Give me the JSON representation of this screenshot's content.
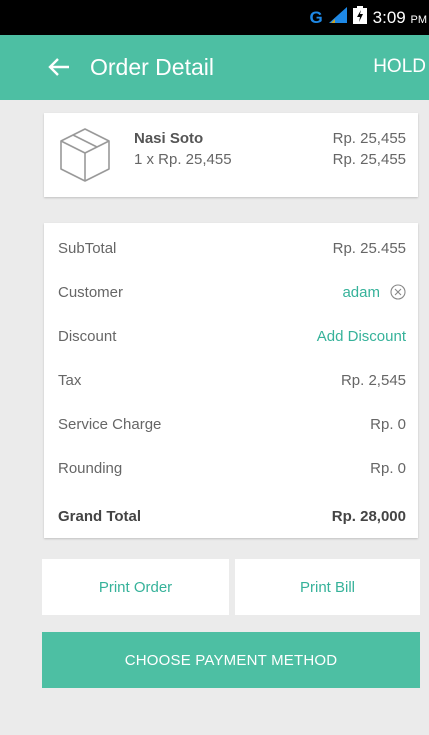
{
  "status_bar": {
    "network": "G",
    "time": "3:09",
    "ampm": "PM"
  },
  "app_bar": {
    "title": "Order Detail",
    "action": "HOLD"
  },
  "order_item": {
    "icon": "box-icon",
    "name": "Nasi Soto",
    "quantity_line": "1 x Rp. 25,455",
    "price_line_1": "Rp. 25,455",
    "price_line_2": "Rp. 25,455"
  },
  "summary": {
    "subtotal": {
      "label": "SubTotal",
      "value": "Rp. 25.455"
    },
    "customer": {
      "label": "Customer",
      "value": "adam"
    },
    "discount": {
      "label": "Discount",
      "value": "Add Discount"
    },
    "tax": {
      "label": "Tax",
      "value": "Rp. 2,545"
    },
    "service_charge": {
      "label": "Service Charge",
      "value": "Rp. 0"
    },
    "rounding": {
      "label": "Rounding",
      "value": "Rp. 0"
    },
    "grand_total": {
      "label": "Grand Total",
      "value": "Rp. 28,000"
    }
  },
  "actions": {
    "print_order": "Print Order",
    "print_bill": "Print Bill",
    "choose_payment": "CHOOSE PAYMENT METHOD"
  },
  "colors": {
    "accent": "#4dbfa3",
    "accent_text": "#36b29a",
    "background": "#ebebeb"
  }
}
